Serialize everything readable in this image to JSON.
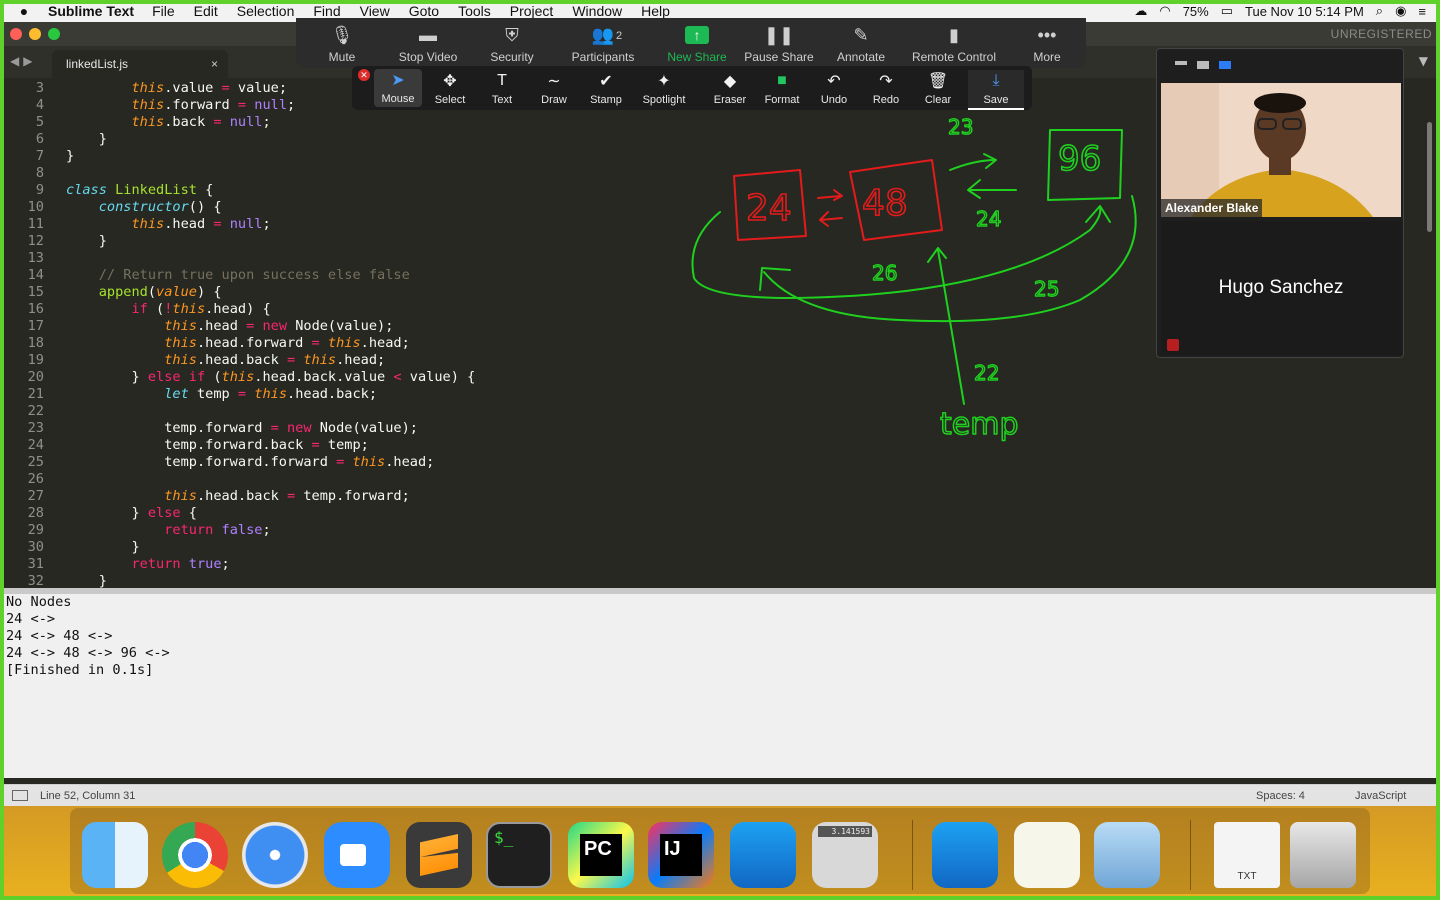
{
  "menubar": {
    "app_name": "Sublime Text",
    "items": [
      "File",
      "Edit",
      "Selection",
      "Find",
      "View",
      "Goto",
      "Tools",
      "Project",
      "Window",
      "Help"
    ],
    "battery": "75%",
    "datetime": "Tue Nov 10  5:14 PM"
  },
  "window": {
    "unregistered": "UNREGISTERED",
    "tab_title": "linkedList.js",
    "tab_close": "×"
  },
  "code": {
    "lines": [
      {
        "n": "3",
        "html": "        <span class='th'>this</span>.value <span class='op'>=</span> value;"
      },
      {
        "n": "4",
        "html": "        <span class='th'>this</span>.forward <span class='op'>=</span> <span class='cn'>null</span>;"
      },
      {
        "n": "5",
        "html": "        <span class='th'>this</span>.back <span class='op'>=</span> <span class='cn'>null</span>;"
      },
      {
        "n": "6",
        "html": "    }"
      },
      {
        "n": "7",
        "html": "}"
      },
      {
        "n": "8",
        "html": ""
      },
      {
        "n": "9",
        "html": "<span class='kw'>class</span> <span class='fn'>LinkedList</span> {"
      },
      {
        "n": "10",
        "html": "    <span class='kw'>constructor</span>() {"
      },
      {
        "n": "11",
        "html": "        <span class='th'>this</span>.head <span class='op'>=</span> <span class='cn'>null</span>;"
      },
      {
        "n": "12",
        "html": "    }"
      },
      {
        "n": "13",
        "html": ""
      },
      {
        "n": "14",
        "html": "    <span class='cm'>// Return true upon success else false</span>"
      },
      {
        "n": "15",
        "html": "    <span class='fn'>append</span>(<span class='pm'>value</span>) {"
      },
      {
        "n": "16",
        "html": "        <span class='ctl'>if</span> (<span class='op'>!</span><span class='th'>this</span>.head) {"
      },
      {
        "n": "17",
        "html": "            <span class='th'>this</span>.head <span class='op'>=</span> <span class='ctl'>new</span> Node(value);"
      },
      {
        "n": "18",
        "html": "            <span class='th'>this</span>.head.forward <span class='op'>=</span> <span class='th'>this</span>.head;"
      },
      {
        "n": "19",
        "html": "            <span class='th'>this</span>.head.back <span class='op'>=</span> <span class='th'>this</span>.head;"
      },
      {
        "n": "20",
        "html": "        } <span class='ctl'>else if</span> (<span class='th'>this</span>.head.back.value <span class='op'>&lt;</span> value) {"
      },
      {
        "n": "21",
        "html": "            <span class='kw'>let</span> temp <span class='op'>=</span> <span class='th'>this</span>.head.back;"
      },
      {
        "n": "22",
        "html": ""
      },
      {
        "n": "23",
        "html": "            temp.forward <span class='op'>=</span> <span class='ctl'>new</span> Node(value);"
      },
      {
        "n": "24",
        "html": "            temp.forward.back <span class='op'>=</span> temp;"
      },
      {
        "n": "25",
        "html": "            temp.forward.forward <span class='op'>=</span> <span class='th'>this</span>.head;"
      },
      {
        "n": "26",
        "html": ""
      },
      {
        "n": "27",
        "html": "            <span class='th'>this</span>.head.back <span class='op'>=</span> temp.forward;"
      },
      {
        "n": "28",
        "html": "        } <span class='ctl'>else</span> {"
      },
      {
        "n": "29",
        "html": "            <span class='ctl'>return</span> <span class='cn'>false</span>;"
      },
      {
        "n": "30",
        "html": "        }"
      },
      {
        "n": "31",
        "html": "        <span class='ctl'>return</span> <span class='cn'>true</span>;"
      },
      {
        "n": "32",
        "html": "    }"
      }
    ]
  },
  "output": {
    "lines": [
      "No Nodes",
      "24 <->",
      "24 <-> 48 <->",
      "24 <-> 48 <-> 96 <->",
      "[Finished in 0.1s]"
    ]
  },
  "statusbar": {
    "position": "Line 52, Column 31",
    "spaces": "Spaces: 4",
    "syntax": "JavaScript"
  },
  "zoom_toolbar": {
    "items": [
      {
        "label": "Mute",
        "icon": "microphone-icon",
        "glyph": "🎙"
      },
      {
        "label": "Stop Video",
        "icon": "video-camera-icon",
        "glyph": "▬"
      },
      {
        "label": "Security",
        "icon": "shield-icon",
        "glyph": "⛨"
      },
      {
        "label": "Participants",
        "icon": "participants-icon",
        "glyph": "👥"
      },
      {
        "label": "New Share",
        "icon": "share-screen-icon",
        "glyph": "↑"
      },
      {
        "label": "Pause Share",
        "icon": "pause-icon",
        "glyph": "❚❚"
      },
      {
        "label": "Annotate",
        "icon": "pencil-icon",
        "glyph": "✎"
      },
      {
        "label": "Remote Control",
        "icon": "mouse-icon",
        "glyph": "▮"
      },
      {
        "label": "More",
        "icon": "more-icon",
        "glyph": "•••"
      }
    ],
    "participants_count": "2",
    "accent": "#1db954"
  },
  "annotation_toolbar": {
    "items": [
      {
        "label": "Mouse",
        "icon": "cursor-icon",
        "glyph": "➤"
      },
      {
        "label": "Select",
        "icon": "move-icon",
        "glyph": "✥"
      },
      {
        "label": "Text",
        "icon": "text-icon",
        "glyph": "T"
      },
      {
        "label": "Draw",
        "icon": "draw-icon",
        "glyph": "∼"
      },
      {
        "label": "Stamp",
        "icon": "checkmark-icon",
        "glyph": "✔"
      },
      {
        "label": "Spotlight",
        "icon": "spotlight-icon",
        "glyph": "✦"
      },
      {
        "label": "Eraser",
        "icon": "eraser-icon",
        "glyph": "◆"
      },
      {
        "label": "Format",
        "icon": "format-icon",
        "glyph": "■"
      },
      {
        "label": "Undo",
        "icon": "undo-icon",
        "glyph": "↶"
      },
      {
        "label": "Redo",
        "icon": "redo-icon",
        "glyph": "↷"
      },
      {
        "label": "Clear",
        "icon": "trash-icon",
        "glyph": "🗑"
      },
      {
        "label": "Save",
        "icon": "save-icon",
        "glyph": "⤓"
      }
    ],
    "format_color": "#22c55e"
  },
  "gallery": {
    "participant1": "Alexander Blake",
    "participant2": "Hugo Sanchez"
  },
  "whiteboard": {
    "red_nodes": [
      "24",
      "48"
    ],
    "green_node": "96",
    "labels": [
      "23",
      "24",
      "26",
      "25",
      "22",
      "temp"
    ]
  },
  "dock": {
    "apps": [
      "finder",
      "chrome",
      "safari",
      "zoom",
      "sublime-text",
      "terminal",
      "pycharm",
      "intellij",
      "xcode",
      "calculator",
      "xcode-2",
      "textedit",
      "preview",
      "txt-file",
      "trash"
    ],
    "terminal_glyph": "$_",
    "pycharm_glyph": "PC",
    "intellij_glyph": "IJ",
    "calculator_display": "3.141593",
    "txt_label": "TXT"
  },
  "colors": {
    "editor_bg": "#272822",
    "share_frame": "#5fd12a",
    "whiteboard_red": "#e31b1b",
    "whiteboard_green": "#1fd01f"
  }
}
